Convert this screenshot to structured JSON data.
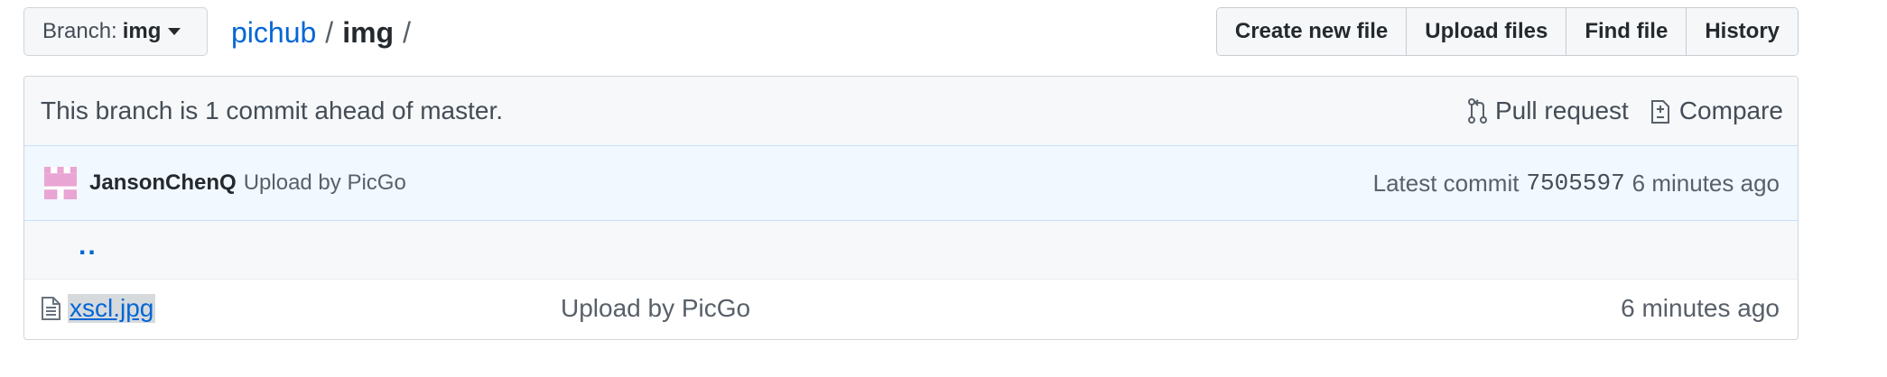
{
  "branch": {
    "label": "Branch:",
    "value": "img"
  },
  "breadcrumb": {
    "repo": "pichub",
    "separator": "/",
    "dir": "img",
    "trailing": "/"
  },
  "actions": [
    {
      "label": "Create new file"
    },
    {
      "label": "Upload files"
    },
    {
      "label": "Find file"
    },
    {
      "label": "History"
    }
  ],
  "ahead": {
    "message": "This branch is 1 commit ahead of master.",
    "pull_request": "Pull request",
    "compare": "Compare"
  },
  "commit": {
    "author": "JansonChenQ",
    "message": "Upload by PicGo",
    "latest_label": "Latest commit",
    "sha": "7505597",
    "age": "6 minutes ago"
  },
  "files": {
    "parent": "..",
    "rows": [
      {
        "name": "xscl.jpg",
        "message": "Upload by PicGo",
        "age": "6 minutes ago"
      }
    ]
  },
  "colors": {
    "link": "#0366d6",
    "commit_bg": "#f1f8ff",
    "avatar": "#e9a5d3"
  }
}
